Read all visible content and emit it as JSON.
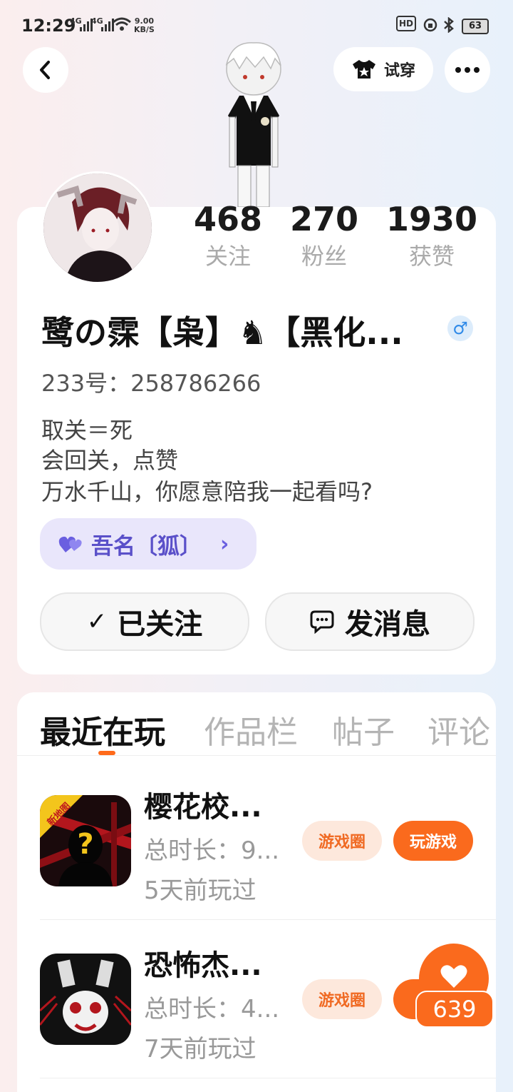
{
  "status_bar": {
    "time": "12:29",
    "signal1": "4G",
    "signal2": "4G",
    "speed_value": "9.00",
    "speed_unit": "KB/S",
    "hd_label": "HD",
    "battery": "63"
  },
  "top_bar": {
    "try_on_label": "试穿"
  },
  "profile": {
    "stats": [
      {
        "value": "468",
        "label": "关注"
      },
      {
        "value": "270",
        "label": "粉丝"
      },
      {
        "value": "1930",
        "label": "获赞"
      }
    ],
    "name": "鹭の霂【枭】♞【黑化...",
    "gender_symbol": "♂",
    "uid": "233号：258786266",
    "bio": [
      "取关＝死",
      "会回关，点赞",
      "万水千山，你愿意陪我一起看吗?"
    ],
    "tag": {
      "label": "吾名〔狐〕",
      "chevron": "›"
    },
    "follow_button": {
      "check": "✓",
      "label": "已关注"
    },
    "message_button": {
      "label": "发消息"
    }
  },
  "tabs": [
    {
      "label": "最近在玩",
      "active": true
    },
    {
      "label": "作品栏",
      "active": false
    },
    {
      "label": "帖子",
      "active": false
    },
    {
      "label": "评论",
      "active": false
    }
  ],
  "games": [
    {
      "title": "樱花校...",
      "duration": "总时长：9...",
      "last_played": "5天前玩过",
      "badge": "新地图",
      "circle_label": "游戏圈",
      "play_label": "玩游戏"
    },
    {
      "title": "恐怖杰...",
      "duration": "总时长：4...",
      "last_played": "7天前玩过",
      "circle_label": "游戏圈",
      "play_label": "玩"
    }
  ],
  "like": {
    "count": "639"
  },
  "colors": {
    "accent": "#fa6a1d",
    "tag_text": "#5a50c9",
    "tag_bg": "#e9e6fb"
  }
}
